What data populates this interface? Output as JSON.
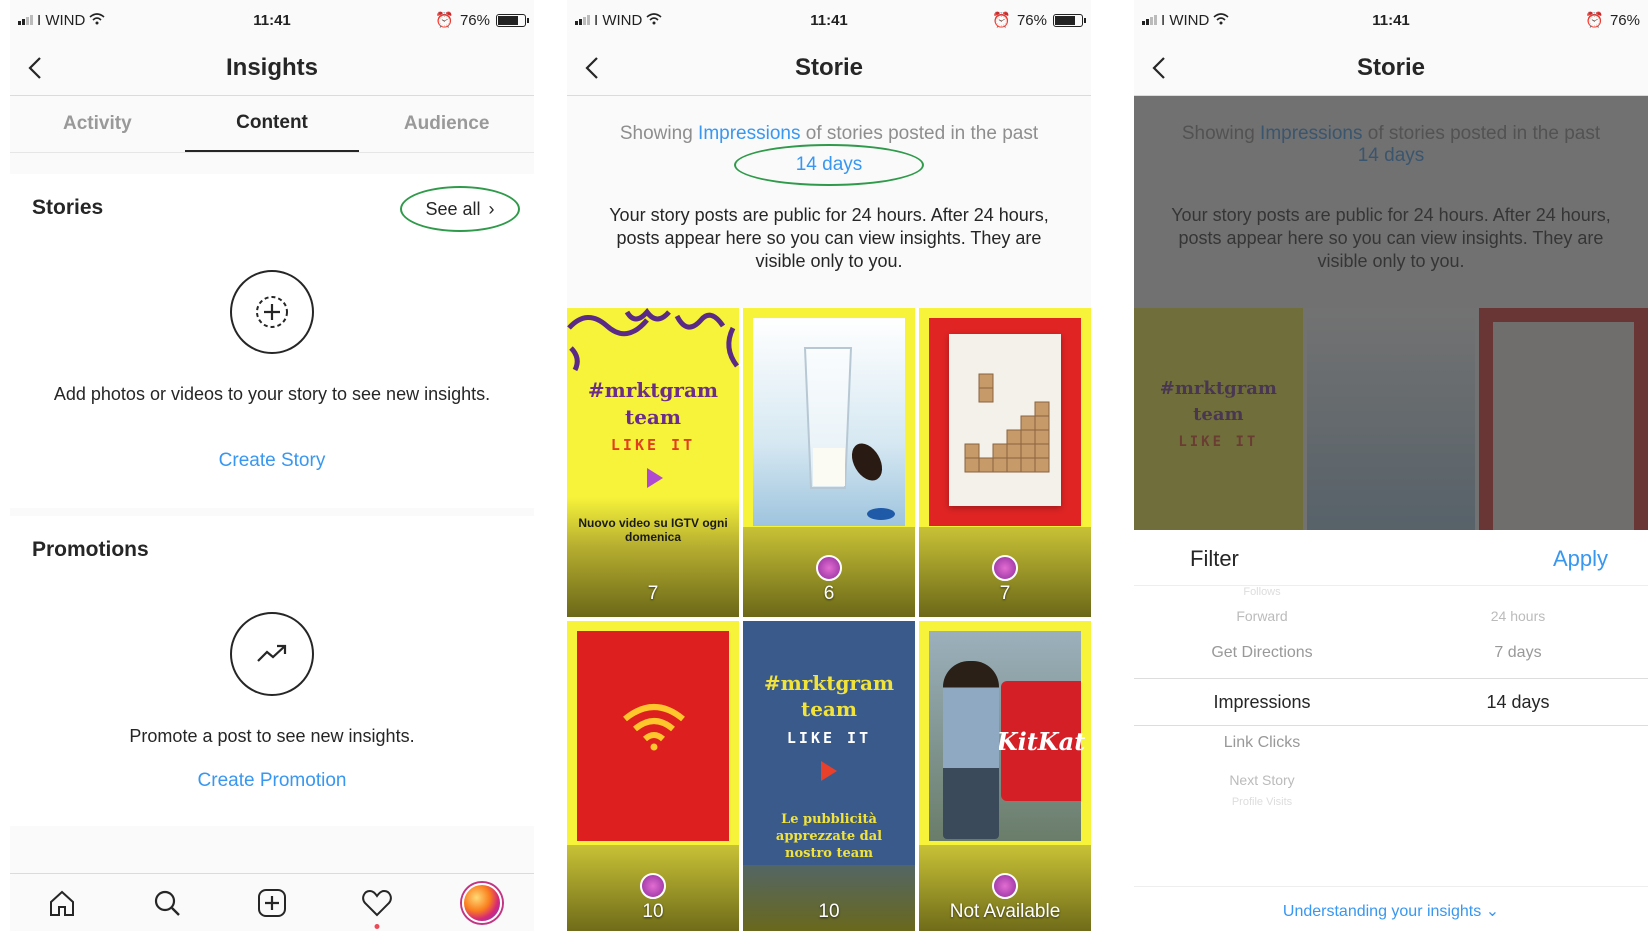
{
  "status": {
    "carrier": "I WIND",
    "time": "11:41",
    "battery": "76%",
    "battery_level": 0.76
  },
  "screen1": {
    "title": "Insights",
    "tabs": [
      "Activity",
      "Content",
      "Audience"
    ],
    "active_tab": "Content",
    "stories": {
      "title": "Stories",
      "see_all": "See all",
      "empty_text": "Add photos or videos to your story to see new insights.",
      "cta": "Create Story"
    },
    "promotions": {
      "title": "Promotions",
      "empty_text": "Promote a post to see new insights.",
      "cta": "Create Promotion"
    }
  },
  "screen2": {
    "title": "Storie",
    "showing_prefix": "Showing",
    "showing_metric": "Impressions",
    "showing_suffix": "of stories posted in the past",
    "period": "14 days",
    "public_text": "Your story posts are public for 24 hours. After 24 hours, posts appear here so you can view insights. They are visible only to you.",
    "tiles": [
      {
        "count": "7",
        "heading": "#mrktgram",
        "heading2": "team",
        "tagline": "LIKE IT",
        "caption": "Nuovo video su IGTV ogni domenica"
      },
      {
        "count": "6"
      },
      {
        "count": "7"
      },
      {
        "count": "10"
      },
      {
        "count": "10",
        "heading": "#mrktgram",
        "heading2": "team",
        "tagline": "LIKE IT",
        "caption": "Le pubblicità apprezzate dal nostro team"
      },
      {
        "count": "Not Available",
        "brand": "KitKat"
      }
    ]
  },
  "screen3": {
    "title": "Storie",
    "filter_title": "Filter",
    "apply_label": "Apply",
    "metrics": [
      "Follows",
      "Forward",
      "Get Directions",
      "Impressions",
      "Link Clicks",
      "Next Story",
      "Profile Visits"
    ],
    "selected_metric": "Impressions",
    "periods": [
      "24 hours",
      "7 days",
      "14 days"
    ],
    "selected_period": "14 days",
    "understanding_link": "Understanding your insights"
  },
  "colors": {
    "accent": "#3897f0",
    "annotation": "#2f9a4a",
    "tile_yellow": "#f5f240",
    "tile_red": "#e02424",
    "tile_blue": "#3a5a8c"
  }
}
